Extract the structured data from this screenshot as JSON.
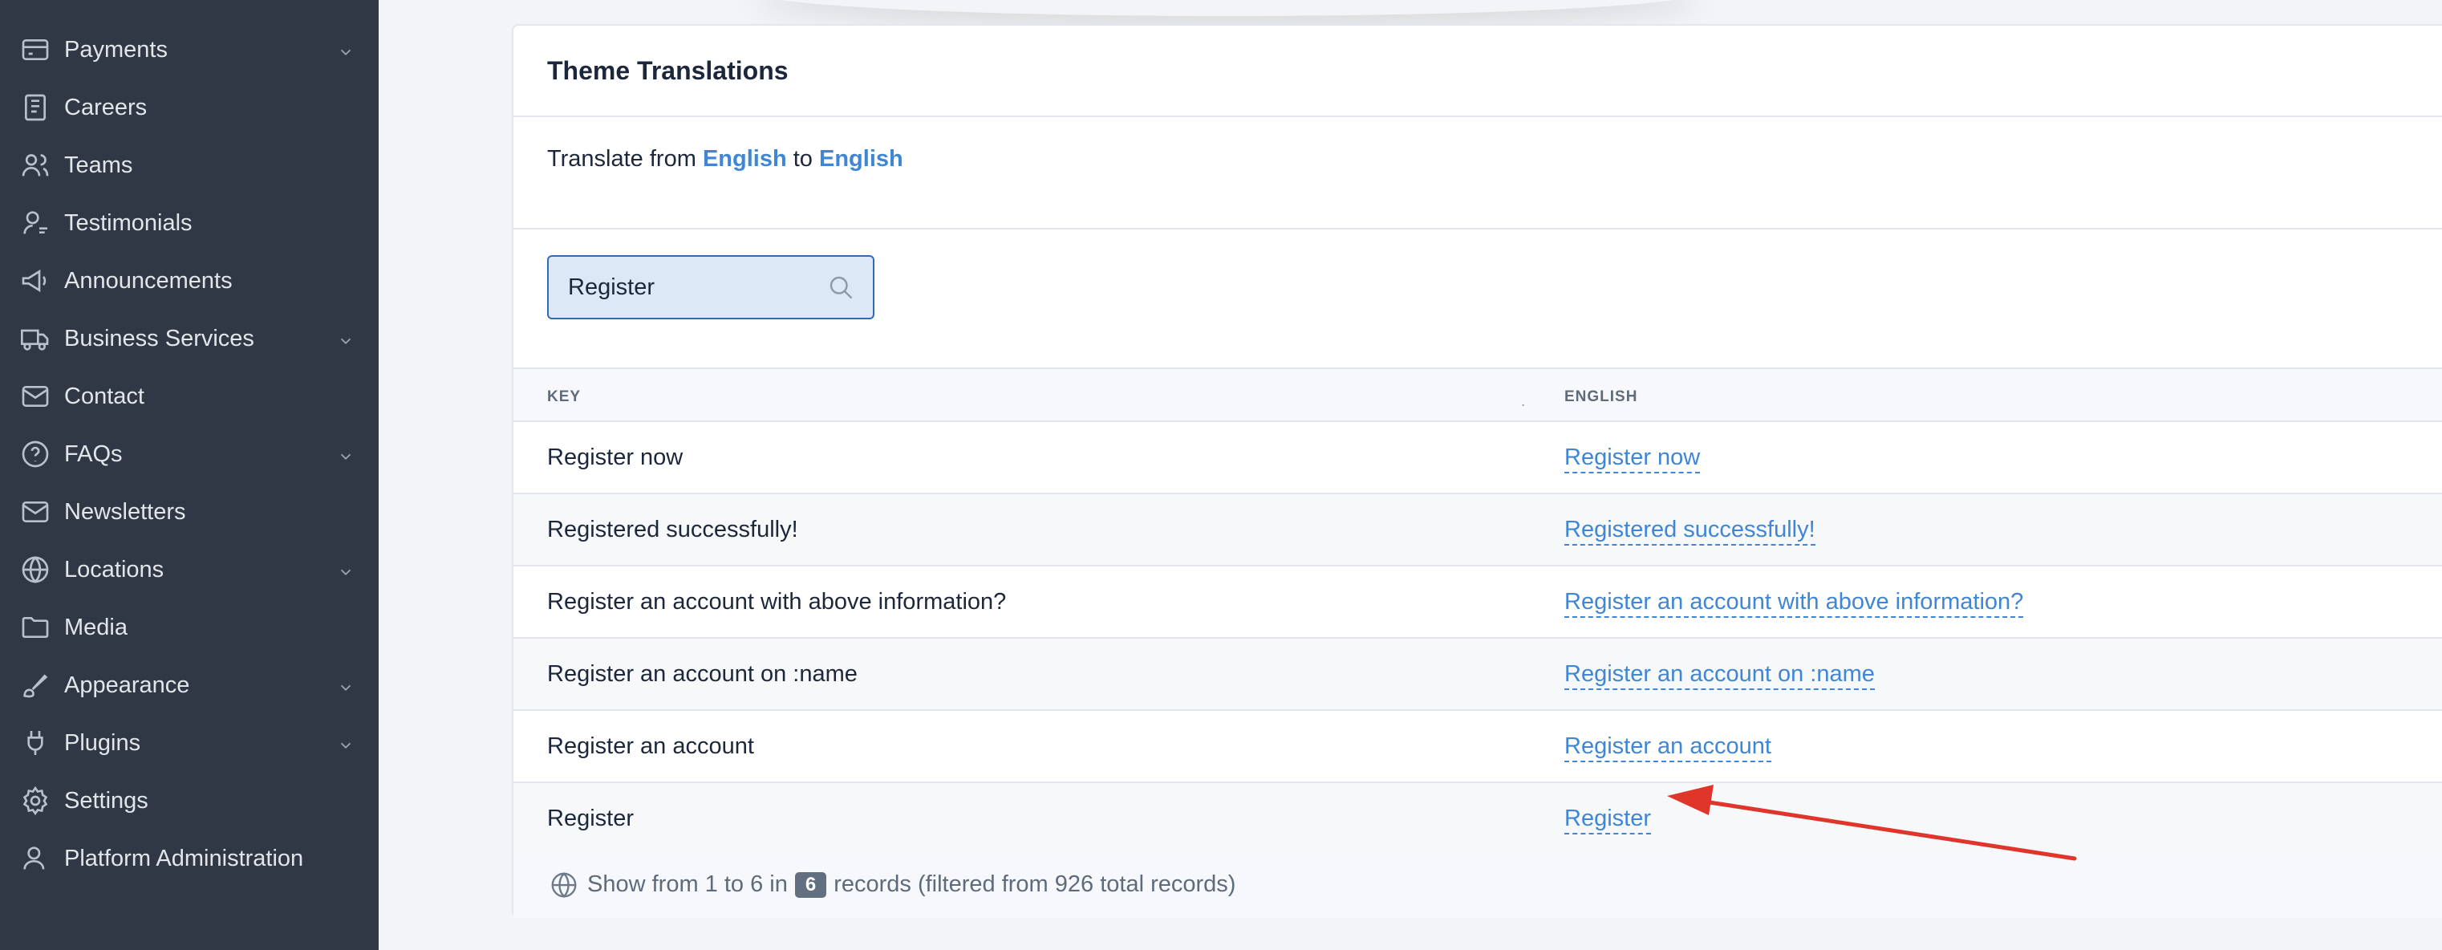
{
  "sidebar": {
    "items": [
      {
        "label": "Payments",
        "icon": "credit-card-icon",
        "has_children": true
      },
      {
        "label": "Careers",
        "icon": "document-icon",
        "has_children": false
      },
      {
        "label": "Teams",
        "icon": "users-icon",
        "has_children": false
      },
      {
        "label": "Testimonials",
        "icon": "user-quote-icon",
        "has_children": false
      },
      {
        "label": "Announcements",
        "icon": "megaphone-icon",
        "has_children": false
      },
      {
        "label": "Business Services",
        "icon": "truck-icon",
        "has_children": true
      },
      {
        "label": "Contact",
        "icon": "mail-icon",
        "has_children": false
      },
      {
        "label": "FAQs",
        "icon": "help-circle-icon",
        "has_children": true
      },
      {
        "label": "Newsletters",
        "icon": "mail-icon",
        "has_children": false
      },
      {
        "label": "Locations",
        "icon": "globe-icon",
        "has_children": true
      },
      {
        "label": "Media",
        "icon": "folder-icon",
        "has_children": false
      },
      {
        "label": "Appearance",
        "icon": "brush-icon",
        "has_children": true
      },
      {
        "label": "Plugins",
        "icon": "plug-icon",
        "has_children": true
      },
      {
        "label": "Settings",
        "icon": "gear-icon",
        "has_children": false
      },
      {
        "label": "Platform Administration",
        "icon": "user-cog-icon",
        "has_children": false
      }
    ]
  },
  "card": {
    "title": "Theme Translations",
    "translate_prefix": "Translate from",
    "from_language": "English",
    "translate_middle": "to",
    "to_language": "English"
  },
  "search": {
    "value": "Register"
  },
  "table": {
    "columns": [
      "KEY",
      "ENGLISH"
    ],
    "rows": [
      {
        "key": "Register now",
        "value": "Register now"
      },
      {
        "key": "Registered successfully!",
        "value": "Registered successfully!"
      },
      {
        "key": "Register an account with above information?",
        "value": "Register an account with above information?"
      },
      {
        "key": "Register an account on :name",
        "value": "Register an account on :name"
      },
      {
        "key": "Register an account",
        "value": "Register an account"
      },
      {
        "key": "Register",
        "value": "Register"
      }
    ]
  },
  "footer": {
    "prefix": "Show from 1 to 6 in",
    "count": "6",
    "suffix": "records (filtered from 926 total records)"
  },
  "colors": {
    "sidebar_bg": "#303846",
    "link": "#3f86d4",
    "annotation_arrow": "#e0352b"
  }
}
